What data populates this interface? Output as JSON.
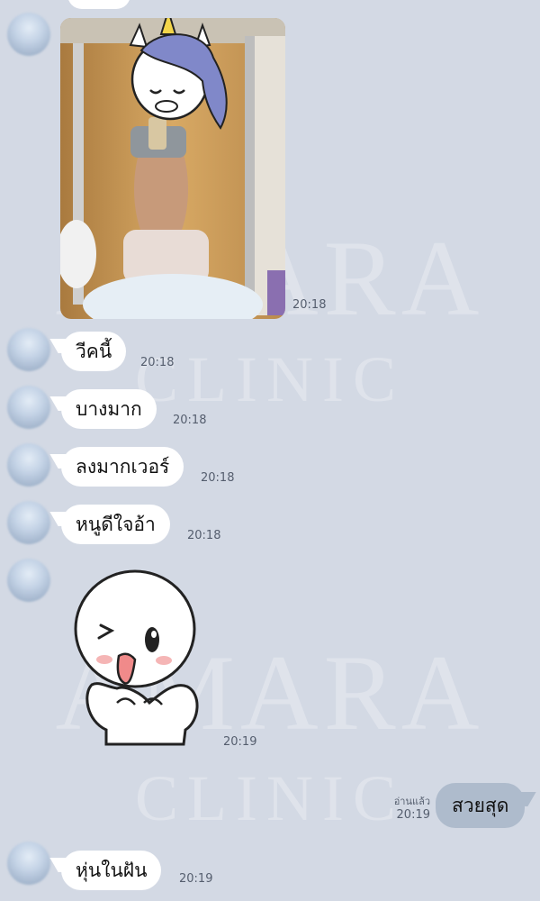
{
  "watermark": {
    "line1": "AMARA",
    "line2": "CLINIC"
  },
  "messages": {
    "photo_time": "20:18",
    "m1": {
      "text": "วีคนี้",
      "time": "20:18"
    },
    "m2": {
      "text": "บางมาก",
      "time": "20:18"
    },
    "m3": {
      "text": "ลงมากเวอร์",
      "time": "20:18"
    },
    "m4": {
      "text": "หนูดีใจอ้า",
      "time": "20:18"
    },
    "sticker_time": "20:19",
    "sent": {
      "text": "สวยสุด",
      "read_label": "อ่านแล้ว",
      "time": "20:19"
    },
    "m5": {
      "text": "หุ่นในฝัน",
      "time": "20:19"
    }
  },
  "colors": {
    "background": "#d3d9e4",
    "incoming_bubble": "#ffffff",
    "outgoing_bubble": "#aebbcc"
  },
  "icons": {
    "photo_overlay": "unicorn-icon",
    "sticker": "wink-face-sticker"
  }
}
